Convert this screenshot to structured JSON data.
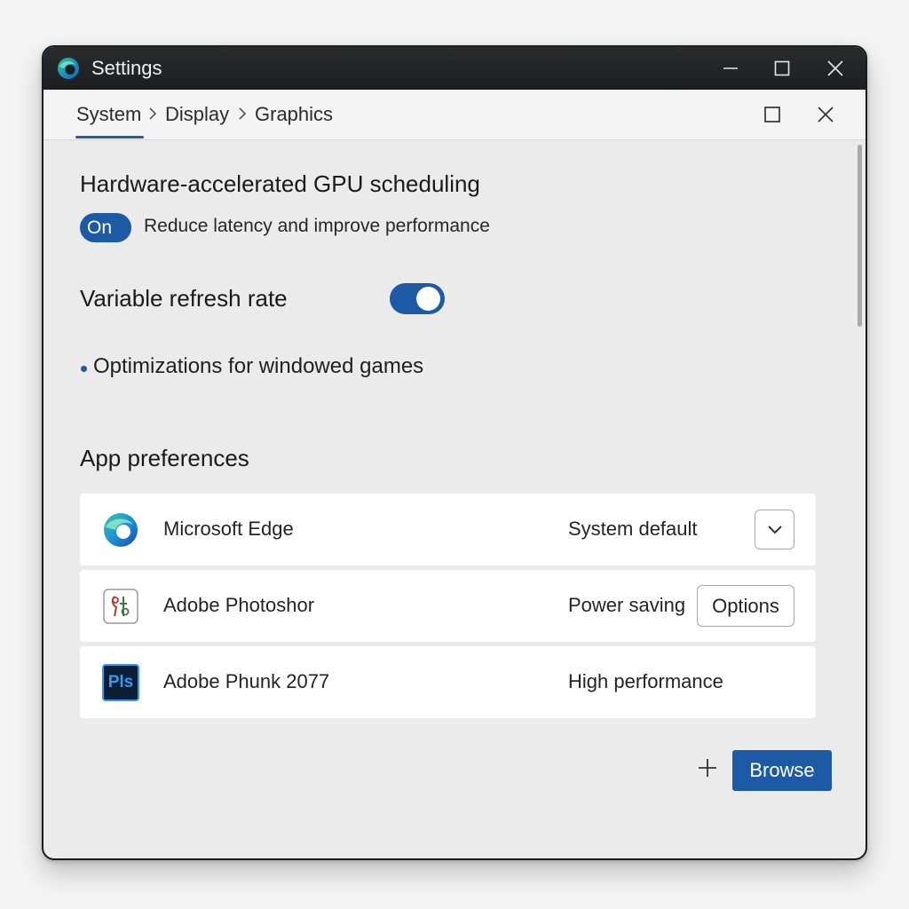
{
  "window": {
    "title": "Settings",
    "app_icon": "edge-icon"
  },
  "window_controls": {
    "minimize_icon": "minimize-icon",
    "maximize_icon": "maximize-icon",
    "close_icon": "close-icon"
  },
  "breadcrumb": {
    "items": [
      "System",
      "Display",
      "Graphics"
    ],
    "separator_icon": "chevron-right-icon"
  },
  "tab_actions": {
    "restore_icon": "maximize-icon",
    "close_icon": "close-icon"
  },
  "gpu_scheduling": {
    "heading": "Hardware-accelerated GPU scheduling",
    "state_label": "On",
    "description": "Reduce latency and improve performance"
  },
  "variable_refresh": {
    "heading": "Variable refresh rate",
    "enabled": true
  },
  "windowed_games": {
    "label": "Optimizations for windowed games"
  },
  "app_preferences": {
    "heading": "App preferences",
    "apps": [
      {
        "name": "Microsoft Edge",
        "preference": "System default",
        "icon": "edge-icon",
        "control": "chevron-down-icon"
      },
      {
        "name": "Adobe Photoshor",
        "preference": "Power saving",
        "icon": "app-placeholder-icon",
        "control_label": "Options"
      },
      {
        "name": "Adobe Phunk 2077",
        "preference": "High performance",
        "icon": "photoshop-icon",
        "icon_text": "Pls"
      }
    ]
  },
  "footer": {
    "add_icon": "plus-icon",
    "browse_label": "Browse"
  },
  "colors": {
    "accent": "#1c5aa6",
    "titlebar": "#1f2022",
    "background": "#ebebeb",
    "row_background": "#ffffff"
  }
}
